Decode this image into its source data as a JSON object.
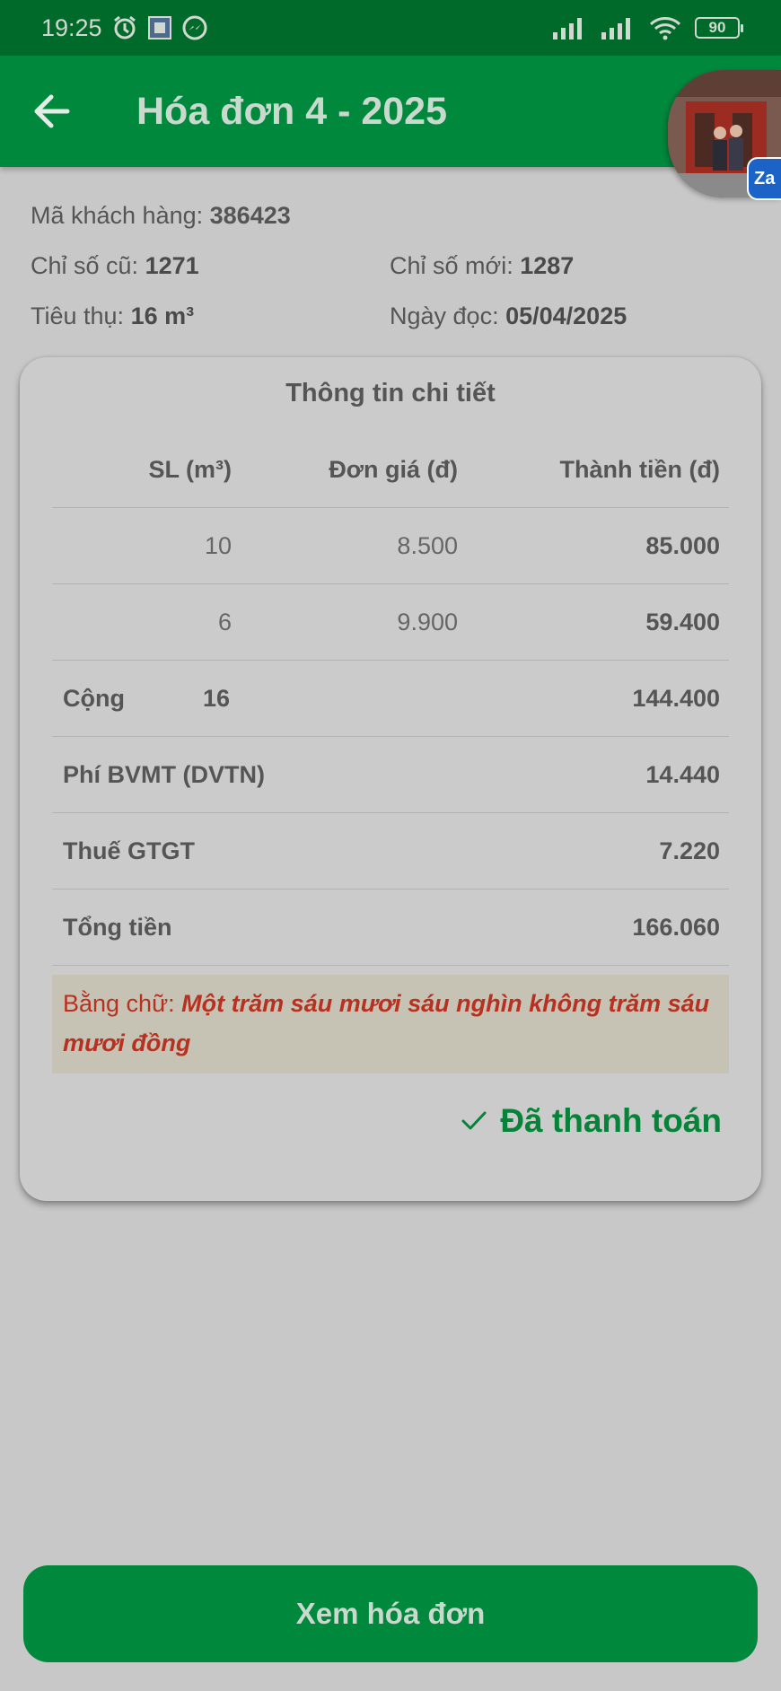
{
  "status_bar": {
    "time": "19:25",
    "battery": "90",
    "icons": [
      "alarm-icon",
      "gallery-icon",
      "messenger-icon",
      "signal-icon",
      "signal-icon",
      "wifi-icon",
      "battery-icon"
    ]
  },
  "header": {
    "title": "Hóa đơn 4 - 2025",
    "back_icon": "arrow-left-icon",
    "bubble_badge": "Za"
  },
  "info": {
    "customer_label": "Mã khách hàng:",
    "customer_value": "386423",
    "old_label": "Chỉ số cũ:",
    "old_value": "1271",
    "new_label": "Chỉ số mới:",
    "new_value": "1287",
    "usage_label": "Tiêu thụ:",
    "usage_value": "16 m³",
    "date_label": "Ngày đọc:",
    "date_value": "05/04/2025"
  },
  "detail": {
    "title": "Thông tin chi tiết",
    "columns": [
      "SL (m³)",
      "Đơn giá (đ)",
      "Thành tiền (đ)"
    ],
    "rows": [
      {
        "qty": "10",
        "price": "8.500",
        "amount": "85.000"
      },
      {
        "qty": "6",
        "price": "9.900",
        "amount": "59.400"
      }
    ],
    "subtotal": {
      "label": "Cộng",
      "qty": "16",
      "amount": "144.400"
    },
    "fee": {
      "label": "Phí BVMT (DVTN)",
      "amount": "14.440"
    },
    "vat": {
      "label": "Thuế GTGT",
      "amount": "7.220"
    },
    "total": {
      "label": "Tổng tiền",
      "amount": "166.060"
    },
    "words_label": "Bằng chữ:",
    "words_value": "Một trăm sáu mươi sáu nghìn không trăm sáu mươi đồng",
    "status": "Đã thanh toán",
    "status_icon": "check-icon"
  },
  "actions": {
    "view_invoice": "Xem hóa đơn"
  },
  "colors": {
    "primary": "#00893d",
    "status_bar": "#006a2a",
    "paid": "#068338",
    "words": "#b83020"
  }
}
